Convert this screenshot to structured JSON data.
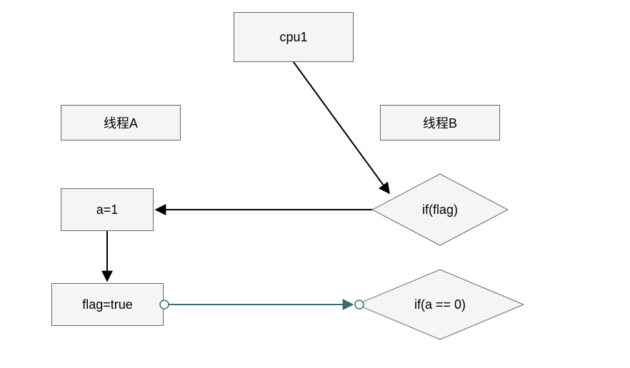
{
  "nodes": {
    "cpu1": {
      "label": "cpu1"
    },
    "threadA": {
      "label": "线程A"
    },
    "threadB": {
      "label": "线程B"
    },
    "a_assign": {
      "label": "a=1"
    },
    "flag_assign": {
      "label": "flag=true"
    },
    "if_flag": {
      "label": "if(flag)"
    },
    "if_a_zero": {
      "label": "if(a == 0)"
    }
  },
  "chart_data": {
    "type": "diagram",
    "title": "",
    "nodes": [
      {
        "id": "cpu1",
        "shape": "rect",
        "label": "cpu1"
      },
      {
        "id": "threadA",
        "shape": "rect",
        "label": "线程A"
      },
      {
        "id": "threadB",
        "shape": "rect",
        "label": "线程B"
      },
      {
        "id": "a_assign",
        "shape": "rect",
        "label": "a=1"
      },
      {
        "id": "flag_assign",
        "shape": "rect",
        "label": "flag=true"
      },
      {
        "id": "if_flag",
        "shape": "diamond",
        "label": "if(flag)"
      },
      {
        "id": "if_a_zero",
        "shape": "diamond",
        "label": "if(a == 0)"
      }
    ],
    "edges": [
      {
        "from": "cpu1",
        "to": "if_flag",
        "style": "solid",
        "color": "#000000"
      },
      {
        "from": "if_flag",
        "to": "a_assign",
        "style": "solid",
        "color": "#000000"
      },
      {
        "from": "a_assign",
        "to": "flag_assign",
        "style": "solid",
        "color": "#000000"
      },
      {
        "from": "flag_assign",
        "to": "if_a_zero",
        "style": "solid",
        "color": "#3a6e6e",
        "endpoints": "circle-arrow"
      }
    ]
  }
}
